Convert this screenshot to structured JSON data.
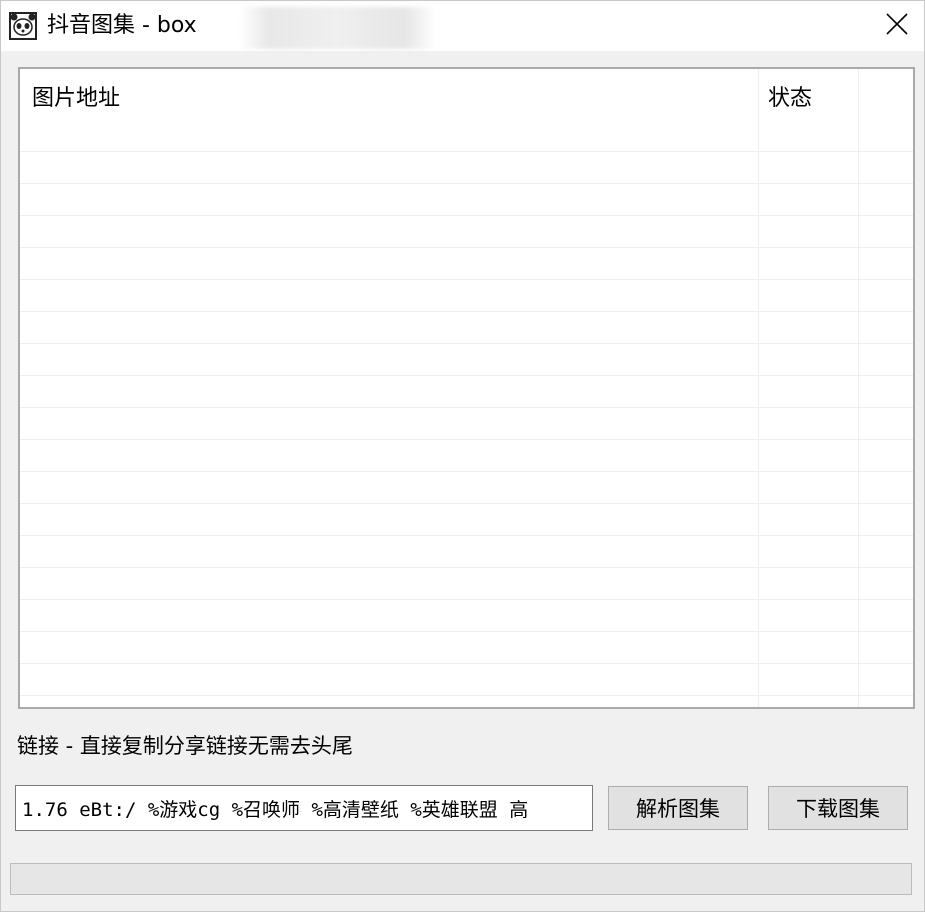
{
  "window": {
    "title": "抖音图集 - box",
    "close_icon": "close-icon",
    "app_icon": "panda-face-icon"
  },
  "listview": {
    "columns": [
      {
        "label": "图片地址"
      },
      {
        "label": "状态"
      }
    ],
    "rows": []
  },
  "link_section": {
    "label": "链接 - 直接复制分享链接无需去头尾",
    "input_value": "1.76 eBt:/ %游戏cg %召唤师 %高清壁纸 %英雄联盟 高"
  },
  "buttons": {
    "parse_label": "解析图集",
    "download_label": "下载图集"
  },
  "progress": {
    "value": 0
  },
  "colors": {
    "window_bg": "#f0f0f0",
    "button_bg": "#e1e1e1",
    "progress_fill": "#06b025"
  }
}
